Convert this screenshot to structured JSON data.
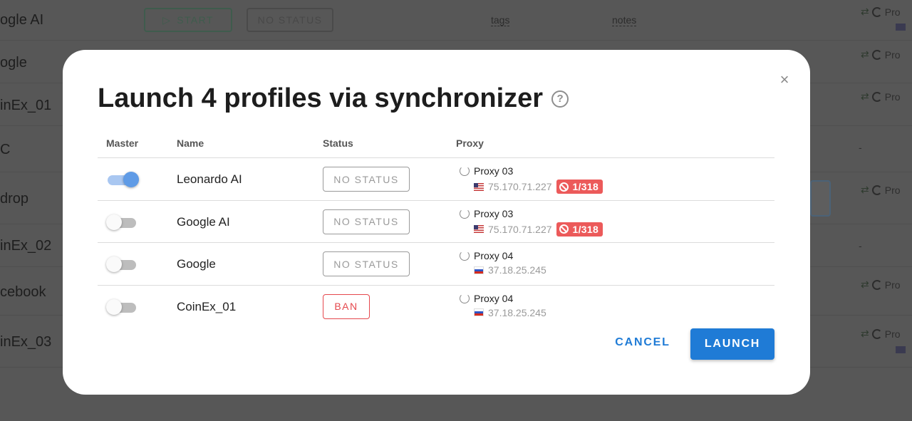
{
  "background": {
    "rows": [
      {
        "name": "ogle AI"
      },
      {
        "name": "ogle"
      },
      {
        "name": "inEx_01"
      },
      {
        "name": "C"
      },
      {
        "name": "drop"
      },
      {
        "name": "inEx_02"
      },
      {
        "name": "cebook"
      },
      {
        "name": "inEx_03"
      }
    ],
    "start_label": "START",
    "status_label": "NO STATUS",
    "tags_label": "tags",
    "notes_label": "notes",
    "proxy_prefix": "Pro",
    "dash": "-"
  },
  "modal": {
    "title": "Launch 4 profiles via synchronizer",
    "help_glyph": "?",
    "close_glyph": "×",
    "columns": {
      "master": "Master",
      "name": "Name",
      "status": "Status",
      "proxy": "Proxy"
    },
    "rows": [
      {
        "master": true,
        "name": "Leonardo AI",
        "status": "NO STATUS",
        "proxy_name": "Proxy 03",
        "flag": "us",
        "ip": "75.170.71.227",
        "ban_count": "1/318"
      },
      {
        "master": false,
        "name": "Google AI",
        "status": "NO STATUS",
        "proxy_name": "Proxy 03",
        "flag": "us",
        "ip": "75.170.71.227",
        "ban_count": "1/318"
      },
      {
        "master": false,
        "name": "Google",
        "status": "NO STATUS",
        "proxy_name": "Proxy 04",
        "flag": "ru",
        "ip": "37.18.25.245",
        "ban_count": ""
      },
      {
        "master": false,
        "name": "CoinEx_01",
        "status": "BAN",
        "proxy_name": "Proxy 04",
        "flag": "ru",
        "ip": "37.18.25.245",
        "ban_count": ""
      }
    ],
    "cancel_label": "CANCEL",
    "launch_label": "LAUNCH"
  },
  "colors": {
    "accent": "#1f7bd6",
    "danger": "#e5484d",
    "toggle_on": "#5f9be6"
  }
}
